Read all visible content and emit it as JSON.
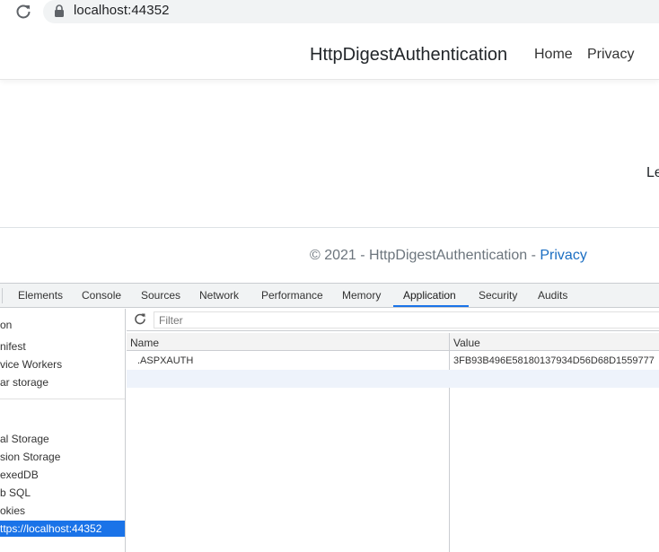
{
  "browser": {
    "url": "localhost:44352"
  },
  "site": {
    "brand": "HttpDigestAuthentication",
    "nav": [
      "Home",
      "Privacy"
    ],
    "main_text": "Le",
    "footer_text": "© 2021 - HttpDigestAuthentication - ",
    "footer_link": "Privacy"
  },
  "devtools": {
    "tabs": [
      "Elements",
      "Console",
      "Sources",
      "Network",
      "Performance",
      "Memory",
      "Application",
      "Security",
      "Audits"
    ],
    "active_tab": "Application",
    "sidebar": {
      "items": [
        "on",
        "nifest",
        "vice Workers",
        "ar storage",
        "al Storage",
        "sion Storage",
        "exedDB",
        "b SQL",
        "okies"
      ],
      "selected": "ttps://localhost:44352"
    },
    "filter_placeholder": "Filter",
    "columns": [
      "Name",
      "Value"
    ],
    "rows": [
      {
        "name": ".ASPXAUTH",
        "value": "3FB93B496E58180137934D56D68D1559777"
      }
    ]
  },
  "colors": {
    "accent": "#1a73e8",
    "link": "#1b6ec2"
  }
}
